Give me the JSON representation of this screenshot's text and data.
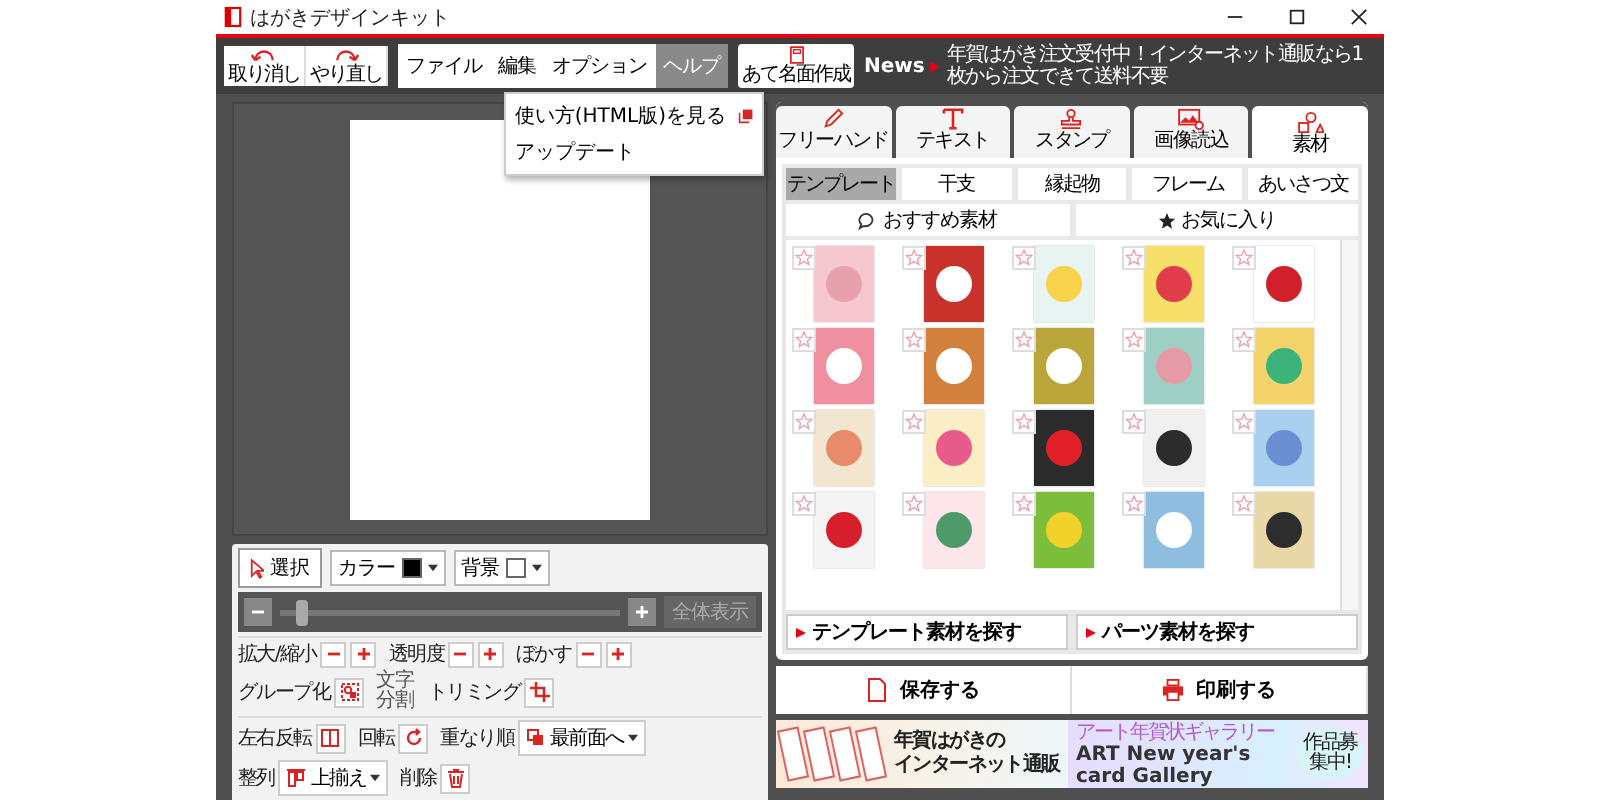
{
  "window": {
    "title": "はがきデザインキット"
  },
  "history_buttons": [
    {
      "kind": "undo",
      "label": "取り消し"
    },
    {
      "kind": "redo",
      "label": "やり直し"
    }
  ],
  "menus": [
    {
      "label": "ファイル",
      "selected": false
    },
    {
      "label": "編集",
      "selected": false
    },
    {
      "label": "オプション",
      "selected": false
    },
    {
      "label": "ヘルプ",
      "selected": true,
      "items": [
        {
          "label": "使い方(HTML版)を見る",
          "external": true
        },
        {
          "label": "アップデート",
          "external": false
        }
      ]
    }
  ],
  "address_button": {
    "label": "あて名面作成"
  },
  "news": {
    "label": "News",
    "text": "年賀はがき注文受付中！インターネット通販なら1枚から注文できて送料不要"
  },
  "tool_tabs": [
    {
      "kind": "pen",
      "label": "フリーハンド",
      "selected": false
    },
    {
      "kind": "text",
      "label": "テキスト",
      "selected": false
    },
    {
      "kind": "stamp",
      "label": "スタンプ",
      "selected": false
    },
    {
      "kind": "image",
      "label": "画像読込",
      "selected": false
    },
    {
      "kind": "shapes",
      "label": "素材",
      "selected": true
    }
  ],
  "categories": [
    {
      "label": "テンプレート",
      "selected": true
    },
    {
      "label": "干支",
      "selected": false
    },
    {
      "label": "縁起物",
      "selected": false
    },
    {
      "label": "フレーム",
      "selected": false
    },
    {
      "label": "あいさつ文",
      "selected": false
    }
  ],
  "filters": [
    {
      "kind": "recommended",
      "label": "おすすめ素材"
    },
    {
      "kind": "favorites",
      "label": "お気に入り"
    }
  ],
  "templates": [
    {
      "favorite": false
    },
    {
      "favorite": false
    },
    {
      "favorite": false
    },
    {
      "favorite": false
    },
    {
      "favorite": false
    },
    {
      "favorite": false
    },
    {
      "favorite": false
    },
    {
      "favorite": false
    },
    {
      "favorite": false
    },
    {
      "favorite": false
    },
    {
      "favorite": false
    },
    {
      "favorite": false
    },
    {
      "favorite": false
    },
    {
      "favorite": false
    },
    {
      "favorite": false
    },
    {
      "favorite": false
    },
    {
      "favorite": false
    },
    {
      "favorite": false
    },
    {
      "favorite": false
    },
    {
      "favorite": false
    }
  ],
  "search_links": [
    "テンプレート素材を探す",
    "パーツ素材を探す"
  ],
  "actions": [
    {
      "kind": "save",
      "label": "保存する"
    },
    {
      "kind": "print",
      "label": "印刷する"
    }
  ],
  "banners": [
    {
      "kind": "shop",
      "lines": [
        "年賀はがきの",
        "インターネット通販"
      ]
    },
    {
      "kind": "gallery",
      "caption": "アート年賀状ギャラリー",
      "title": "ART New year's card Gallery",
      "badge": "作品募集中!"
    }
  ],
  "toolbar": {
    "select": {
      "label": "選択",
      "selected": true
    },
    "color": {
      "label": "カラー"
    },
    "background": {
      "label": "背景"
    },
    "zoom": {
      "level": 0.05
    },
    "fit": {
      "label": "全体表示",
      "disabled": true
    }
  },
  "tool_rows": [
    [
      {
        "kind": "stepper",
        "label": "拡大/縮小"
      },
      {
        "kind": "stepper",
        "label": "透明度"
      },
      {
        "kind": "stepper",
        "label": "ぼかす"
      },
      {
        "kind": "group",
        "label": "グループ化"
      },
      {
        "kind": "note",
        "label": "文字分割"
      },
      {
        "kind": "crop",
        "label": "トリミング"
      }
    ],
    [
      {
        "kind": "flip",
        "label": "左右反転"
      },
      {
        "kind": "rotate",
        "label": "回転"
      },
      {
        "kind": "order",
        "label": "重なり順",
        "value": "最前面へ"
      },
      {
        "kind": "align",
        "label": "整列",
        "value": "上揃え"
      },
      {
        "kind": "trash",
        "label": "削除"
      }
    ]
  ]
}
